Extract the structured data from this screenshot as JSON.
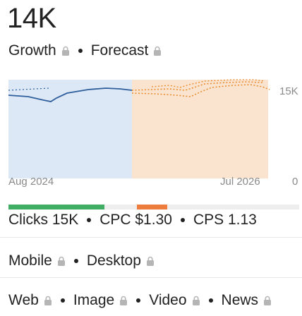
{
  "keyword": {
    "volume": "14K",
    "growth_label": "Growth",
    "forecast_label": "Forecast"
  },
  "trend_chart": {
    "y_max_label": "15K",
    "y_min_label": "0",
    "x_start_label": "Aug 2024",
    "x_end_label": "Jul 2026",
    "colors": {
      "history_fill": "#dce8f6",
      "forecast_fill": "#fbe4cf",
      "history_line": "#2e5e9c",
      "forecast_line": "#e88a2c"
    }
  },
  "difficulty_bar": {
    "colors": {
      "green": "#3fae64",
      "orange": "#ee7c3c",
      "track": "#eeeeee"
    }
  },
  "metrics": {
    "clicks": "Clicks 15K",
    "cpc": "CPC $1.30",
    "cps": "CPS 1.13"
  },
  "devices": {
    "mobile": "Mobile",
    "desktop": "Desktop"
  },
  "search_types": {
    "web": "Web",
    "image": "Image",
    "video": "Video",
    "news": "News"
  }
}
